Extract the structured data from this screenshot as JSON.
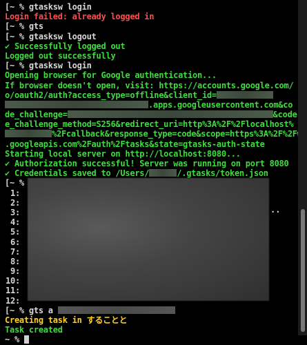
{
  "terminal": {
    "lines": [
      {
        "text": "[~ % gtasksw login",
        "kind": "prompt"
      },
      {
        "text": "Login failed: already logged in",
        "kind": "err"
      },
      {
        "text": "[~ % gts",
        "kind": "prompt"
      },
      {
        "text": "[~ % gtasksw logout",
        "kind": "prompt"
      },
      {
        "text": "✔ Successfully logged out",
        "kind": "ok"
      },
      {
        "text": "Logged out successfully",
        "kind": "ok"
      },
      {
        "text": "[~ % gtasksw login",
        "kind": "prompt"
      },
      {
        "text": "Opening browser for Google authentication...",
        "kind": "ok"
      },
      {
        "text": "If browser doesn't open, visit: https://accounts.google.com/",
        "kind": "ok"
      },
      {
        "text": "o/oauth2/auth?access_type=offline&client_id=",
        "kind": "ok"
      },
      {
        "text": ".apps.googleusercontent.com&co",
        "kind": "ok"
      },
      {
        "text": "de_challenge=",
        "kind": "ok",
        "after": "&code"
      },
      {
        "text": "e_challenge_method=S256&redirect_uri=http%3A%2F%2Flocalhost%",
        "kind": "ok"
      },
      {
        "text": "%2Fcallback&response_type=code&scope=https%3A%2F%2Fwww",
        "kind": "ok"
      },
      {
        "text": ".googleapis.com%2Fauth%2Ftasks&state=gtasks-auth-state",
        "kind": "ok"
      },
      {
        "text": "Starting local server on http://localhost:8080...",
        "kind": "ok"
      },
      {
        "text": "✔ Authorization successful! Server was running on port 8080",
        "kind": "ok"
      },
      {
        "text": "✔ Credentials saved to /Users/",
        "kind": "ok",
        "after": "/.gtasks/token.json"
      },
      {
        "text": "[~ % gts",
        "kind": "prompt"
      }
    ],
    "numbered": [
      "1:",
      "2:",
      "3:",
      "4:",
      "5:",
      "6:",
      "7:",
      "8:",
      "9:",
      "10:",
      "11:",
      "12:"
    ],
    "ellipsis": "..",
    "after_lines": [
      {
        "text": "[~ % gts a",
        "kind": "prompt"
      },
      {
        "text": "Creating task in することと",
        "kind": "ja"
      },
      {
        "text": "Task created",
        "kind": "ok"
      },
      {
        "text": "~ % ",
        "kind": "prompt"
      }
    ]
  },
  "colors": {
    "background": "#000000",
    "prompt": "#d7d7d7",
    "error": "#ff4c4c",
    "success": "#3fdc3f",
    "highlight": "#ffd21f"
  }
}
